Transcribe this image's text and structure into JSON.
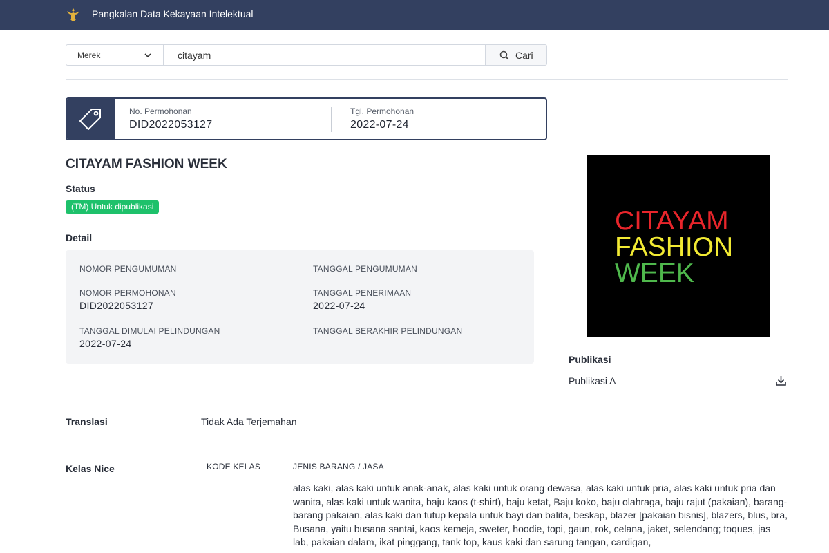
{
  "header": {
    "title": "Pangkalan Data Kekayaan Intelektual",
    "logo_icon": "garuda-emblem-icon"
  },
  "search": {
    "type_selected": "Merek",
    "query": "citayam",
    "button_label": "Cari"
  },
  "application": {
    "no_label": "No. Permohonan",
    "no_value": "DID2022053127",
    "date_label": "Tgl. Permohonan",
    "date_value": "2022-07-24"
  },
  "mark_name": "CITAYAM FASHION WEEK",
  "status": {
    "heading": "Status",
    "badge": "(TM) Untuk dipublikasi",
    "badge_color": "#1ec16b"
  },
  "detail": {
    "heading": "Detail",
    "fields": {
      "nomor_pengumuman": {
        "label": "NOMOR PENGUMUMAN",
        "value": ""
      },
      "tanggal_pengumuman": {
        "label": "TANGGAL PENGUMUMAN",
        "value": ""
      },
      "nomor_permohonan": {
        "label": "NOMOR PERMOHONAN",
        "value": "DID2022053127"
      },
      "tanggal_penerimaan": {
        "label": "TANGGAL PENERIMAAN",
        "value": "2022-07-24"
      },
      "tanggal_dimulai": {
        "label": "TANGGAL DIMULAI PELINDUNGAN",
        "value": "2022-07-24"
      },
      "tanggal_berakhir": {
        "label": "TANGGAL BERAKHIR PELINDUNGAN",
        "value": ""
      }
    }
  },
  "mark_image": {
    "lines": [
      "CITAYAM",
      "FASHION",
      "WEEK"
    ],
    "colors": [
      "#e8252b",
      "#f2ea33",
      "#4fb84c"
    ],
    "background": "#000000"
  },
  "publication": {
    "heading": "Publikasi",
    "item": "Publikasi A",
    "download_icon": "download-icon"
  },
  "translation": {
    "heading": "Translasi",
    "value": "Tidak Ada Terjemahan"
  },
  "nice": {
    "heading": "Kelas Nice",
    "col_code": "KODE KELAS",
    "col_goods": "JENIS BARANG / JASA",
    "goods_text": "alas kaki, alas kaki untuk anak-anak, alas kaki untuk orang dewasa, alas kaki untuk pria, alas kaki untuk pria dan wanita, alas kaki untuk wanita, baju kaos (t-shirt), baju ketat, Baju koko, baju olahraga, baju rajut (pakaian), barang-barang pakaian, alas kaki dan tutup kepala untuk bayi dan balita, beskap, blazer [pakaian bisnis], blazers, blus, bra, Busana, yaitu busana santai, kaos kemeja, sweter, hoodie, topi, gaun, rok, celana, jaket, selendang; toques, jas lab, pakaian dalam, ikat pinggang, tank top, kaus kaki dan sarung tangan, cardigan,"
  },
  "theme": {
    "navy": "#334060"
  }
}
